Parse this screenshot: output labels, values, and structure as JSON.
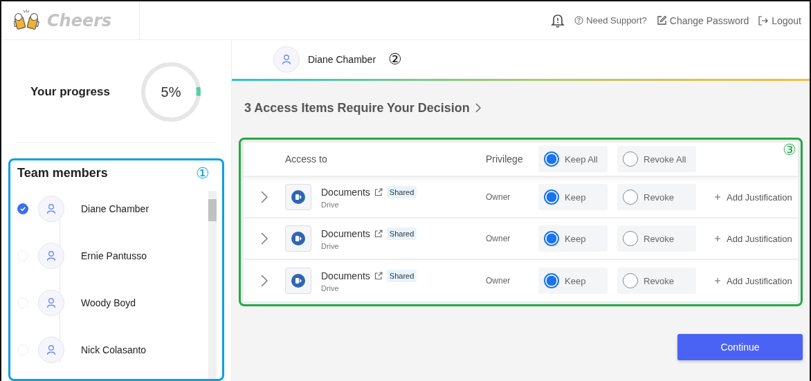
{
  "topbar": {
    "brand": "Cheers",
    "links": [
      {
        "kind": "support",
        "label": "Need Support?"
      },
      {
        "kind": "password",
        "label": "Change Password"
      },
      {
        "kind": "logout",
        "label": "Logout"
      }
    ]
  },
  "progress": {
    "label": "Your progress",
    "value": "5%",
    "level": 0.05
  },
  "team_members": {
    "title": "Team members",
    "callout": "①",
    "members": [
      {
        "name": "Diane Chamber",
        "selected": true
      },
      {
        "name": "Ernie Pantusso",
        "selected": false
      },
      {
        "name": "Woody Boyd",
        "selected": false
      },
      {
        "name": "Nick Colasanto",
        "selected": false
      }
    ]
  },
  "user_header": {
    "name": "Diane Chamber",
    "callout": "②"
  },
  "decision_title": "3 Access Items Require Your Decision",
  "table": {
    "callout": "③",
    "columns": {
      "access": "Access to",
      "privilege": "Privilege"
    },
    "bulk_options": [
      {
        "label": "Keep All",
        "selected": true
      },
      {
        "label": "Revoke All",
        "selected": false
      }
    ],
    "rows": [
      {
        "name": "Documents",
        "tag": "Shared",
        "source": "Drive",
        "privilege": "Owner",
        "options": [
          {
            "label": "Keep",
            "selected": true
          },
          {
            "label": "Revoke",
            "selected": false
          }
        ],
        "action": "Add Justification"
      },
      {
        "name": "Documents",
        "tag": "Shared",
        "source": "Drive",
        "privilege": "Owner",
        "options": [
          {
            "label": "Keep",
            "selected": true
          },
          {
            "label": "Revoke",
            "selected": false
          }
        ],
        "action": "Add Justification"
      },
      {
        "name": "Documents",
        "tag": "Shared",
        "source": "Drive",
        "privilege": "Owner",
        "options": [
          {
            "label": "Keep",
            "selected": true
          },
          {
            "label": "Revoke",
            "selected": false
          }
        ],
        "action": "Add Justification"
      }
    ]
  },
  "continue_button": "Continue"
}
